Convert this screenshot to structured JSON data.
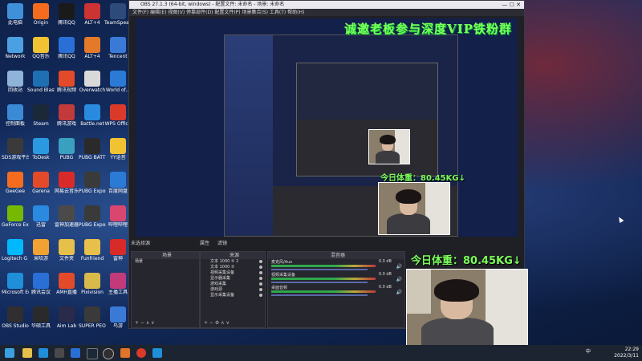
{
  "desktop_icons": [
    {
      "label": "此电脑",
      "color": "#3f8fd9"
    },
    {
      "label": "Origin",
      "color": "#f56c1f"
    },
    {
      "label": "腾讯QQ",
      "color": "#1a1a1a"
    },
    {
      "label": "ALT+4",
      "color": "#cc3333"
    },
    {
      "label": "TeamSpeak 3",
      "color": "#2d4a7a"
    },
    {
      "label": "Network",
      "color": "#4aa0e0"
    },
    {
      "label": "QQ音乐",
      "color": "#f1c232"
    },
    {
      "label": "腾讯QQ",
      "color": "#2a6fd6"
    },
    {
      "label": "ALT+4",
      "color": "#e27a2a"
    },
    {
      "label": "Tencent",
      "color": "#3a7ad6"
    },
    {
      "label": "回收站",
      "color": "#8fb3d9"
    },
    {
      "label": "Sound Blaster...",
      "color": "#1f6fb3"
    },
    {
      "label": "腾讯视频",
      "color": "#e24a2a"
    },
    {
      "label": "Overwatch",
      "color": "#d9d9d9"
    },
    {
      "label": "World of...",
      "color": "#2a7ad6"
    },
    {
      "label": "控制面板",
      "color": "#3a8ad6"
    },
    {
      "label": "Steam",
      "color": "#1b2838"
    },
    {
      "label": "腾讯游戏",
      "color": "#c23a3a"
    },
    {
      "label": "Battle.net",
      "color": "#2a8ae0"
    },
    {
      "label": "WPS Office",
      "color": "#d93a2a"
    },
    {
      "label": "SDS游戏平台",
      "color": "#3a3a3a"
    },
    {
      "label": "ToDesk",
      "color": "#2a9ae0"
    },
    {
      "label": "PUBG",
      "color": "#3aa0c0"
    },
    {
      "label": "PUBG BATTLEGR...",
      "color": "#2a2a2a"
    },
    {
      "label": "YY语音",
      "color": "#f1c232"
    },
    {
      "label": "GeeGee",
      "color": "#f56c1f"
    },
    {
      "label": "Garena",
      "color": "#e24a2a"
    },
    {
      "label": "网易云音乐",
      "color": "#d92a2a"
    },
    {
      "label": "PUBG Export...",
      "color": "#3a3a3a"
    },
    {
      "label": "百度网盘",
      "color": "#2a7ad6"
    },
    {
      "label": "GeForce Experience",
      "color": "#76b900"
    },
    {
      "label": "迅雷",
      "color": "#2a8ae0"
    },
    {
      "label": "雷神加速器",
      "color": "#4a4a4a"
    },
    {
      "label": "PUBG Export...",
      "color": "#3a3a3a"
    },
    {
      "label": "哔哩哔哩",
      "color": "#d9466f"
    },
    {
      "label": "Logitech G HUB",
      "color": "#00b8fc"
    },
    {
      "label": "米哈游",
      "color": "#f1a232"
    },
    {
      "label": "文件夹",
      "color": "#e6c04a"
    },
    {
      "label": "Funfriend",
      "color": "#e6c04a"
    },
    {
      "label": "雷神",
      "color": "#d92a2a"
    },
    {
      "label": "Microsoft Edge",
      "color": "#1f8fd9"
    },
    {
      "label": "腾讯会议",
      "color": "#2a6fd6"
    },
    {
      "label": "AMH直播",
      "color": "#e24a2a"
    },
    {
      "label": "Pixivision",
      "color": "#d9b94a"
    },
    {
      "label": "主播工具",
      "color": "#c23a7a"
    },
    {
      "label": "OBS Studio",
      "color": "#302e31"
    },
    {
      "label": "华硕工具",
      "color": "#2a2a2a"
    },
    {
      "label": "Aim Lab",
      "color": "#2a2a4a"
    },
    {
      "label": "SUPER PEOPLE",
      "color": "#3a3a3a"
    },
    {
      "label": "鸟游",
      "color": "#3a7ad6"
    }
  ],
  "obs": {
    "title": "OBS 27.1.3 (64-bit, windows) - 配置文件: 未命名 - 场景: 未命名",
    "menu": "文件(F)  编辑(E)  视图(V)  停靠部件(D)  配置文件(P)  场景集合(S)  工具(T)  帮助(H)",
    "banner": "诚邀老板参与深度VIP铁粉群",
    "weight_small": "今日体重：80.45KG↓",
    "no_source": "未选择源",
    "tab_properties": "属性",
    "tab_filters": "滤镜",
    "scenes_header": "场景",
    "scene_item": "场景",
    "sources_header": "来源",
    "sources": [
      "文本 1000 ⑤ 2",
      "文本 1000 ⑤",
      "视频采集设备",
      "显示器采集",
      "游戏采集",
      "游戏源",
      "显示采集设备"
    ],
    "mixer_header": "混音器",
    "mixer": [
      {
        "name": "麦克风/Aux",
        "db": "0.0 dB"
      },
      {
        "name": "视频采集设备",
        "db": "0.0 dB"
      },
      {
        "name": "桌面音频",
        "db": "0.0 dB"
      }
    ],
    "transition_header": "场景过渡",
    "controls_header": "控制"
  },
  "overlay": {
    "weight_big": "今日体重：80.45KG↓"
  },
  "taskbar": {
    "time": "22:29",
    "date": "2022/3/11",
    "ime": "中"
  },
  "colors": {
    "banner_green": "#7cff5a",
    "taskbar": "#1b2430",
    "obs_bg": "#1f1f26"
  }
}
